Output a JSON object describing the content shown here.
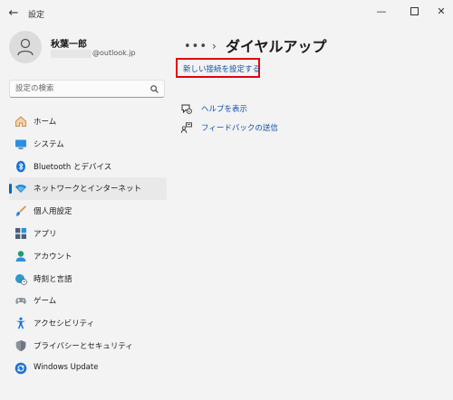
{
  "window": {
    "title": "設定",
    "back_icon": "arrow-left-icon",
    "controls": [
      "minimize-icon",
      "maximize-icon",
      "close-icon"
    ]
  },
  "profile": {
    "name": "秋葉一郎",
    "email_visible": "@outlook.jp"
  },
  "search": {
    "placeholder": "設定の検索",
    "icon": "search-icon"
  },
  "sidebar": {
    "items": [
      {
        "label": "ホーム",
        "icon": "home-icon"
      },
      {
        "label": "システム",
        "icon": "system-icon"
      },
      {
        "label": "Bluetooth とデバイス",
        "icon": "bluetooth-icon"
      },
      {
        "label": "ネットワークとインターネット",
        "icon": "network-icon",
        "active": true
      },
      {
        "label": "個人用設定",
        "icon": "brush-icon"
      },
      {
        "label": "アプリ",
        "icon": "apps-icon"
      },
      {
        "label": "アカウント",
        "icon": "account-icon"
      },
      {
        "label": "時刻と言語",
        "icon": "globe-clock-icon"
      },
      {
        "label": "ゲーム",
        "icon": "gamepad-icon"
      },
      {
        "label": "アクセシビリティ",
        "icon": "accessibility-icon"
      },
      {
        "label": "プライバシーとセキュリティ",
        "icon": "shield-icon"
      },
      {
        "label": "Windows Update",
        "icon": "windows-update-icon"
      }
    ]
  },
  "main": {
    "breadcrumb_overflow": "•••",
    "breadcrumb_separator": "›",
    "page_title": "ダイヤルアップ",
    "new_connection_link": "新しい接続を設定する",
    "help_link": "ヘルプを表示",
    "feedback_link": "フィードバックの送信"
  },
  "colors": {
    "accent": "#0067c0",
    "link": "#0f4ea8",
    "highlight_box": "#e60012",
    "background": "#f3f3f3"
  }
}
